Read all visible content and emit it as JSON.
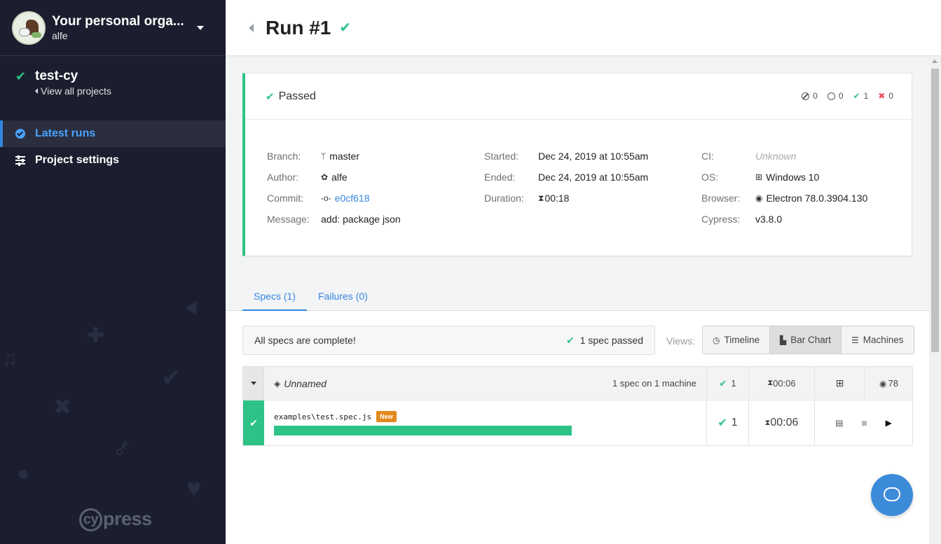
{
  "org": {
    "name": "Your personal orga...",
    "user": "alfe"
  },
  "project": {
    "name": "test-cy",
    "view_all": "View all projects"
  },
  "nav": [
    {
      "label": "Latest runs",
      "icon": "check-circle-icon",
      "active": true
    },
    {
      "label": "Project settings",
      "icon": "sliders-icon",
      "active": false
    }
  ],
  "brand": "press",
  "brand_mark": "cy",
  "header": {
    "title": "Run #1"
  },
  "summary": {
    "status": "Passed",
    "counts": {
      "skipped": "0",
      "pending": "0",
      "passed": "1",
      "failed": "0"
    },
    "branch_label": "Branch:",
    "branch": "master",
    "author_label": "Author:",
    "author": "alfe",
    "commit_label": "Commit:",
    "commit": "e0cf618",
    "message_label": "Message:",
    "message": "add: package json",
    "started_label": "Started:",
    "started": "Dec 24, 2019 at 10:55am",
    "ended_label": "Ended:",
    "ended": "Dec 24, 2019 at 10:55am",
    "duration_label": "Duration:",
    "duration": "00:18",
    "ci_label": "CI:",
    "ci": "Unknown",
    "os_label": "OS:",
    "os": "Windows 10",
    "browser_label": "Browser:",
    "browser": "Electron 78.0.3904.130",
    "cypress_label": "Cypress:",
    "cypress": "v3.8.0"
  },
  "tabs": [
    {
      "label": "Specs (1)",
      "active": true
    },
    {
      "label": "Failures (0)",
      "active": false
    }
  ],
  "specs": {
    "complete_text": "All specs are complete!",
    "passed_text": "1 spec passed",
    "views_label": "Views:",
    "views": [
      {
        "label": "Timeline",
        "icon": "clock-icon",
        "selected": false
      },
      {
        "label": "Bar Chart",
        "icon": "bar-chart-icon",
        "selected": true
      },
      {
        "label": "Machines",
        "icon": "server-icon",
        "selected": false
      }
    ],
    "group": {
      "name": "Unnamed",
      "machine_text": "1 spec on 1 machine",
      "passed": "1",
      "duration": "00:06",
      "browser_version": "78"
    },
    "row": {
      "file": "examples\\test.spec.js",
      "badge": "New",
      "passed": "1",
      "duration": "00:06",
      "progress": 1.0
    }
  },
  "colors": {
    "accent": "#3486e0",
    "success": "#2dc387",
    "sidebar": "#1b1e2e",
    "badge": "#e38a1d"
  }
}
